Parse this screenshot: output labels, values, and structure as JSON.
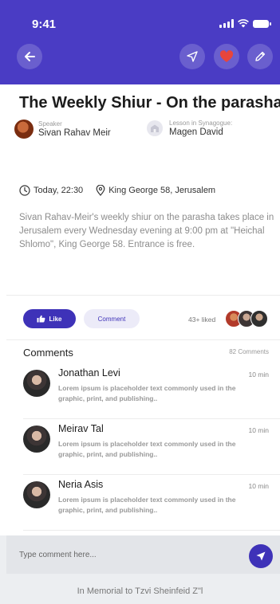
{
  "status_bar": {
    "time": "9:41"
  },
  "header": {
    "back_icon": "arrow-left-icon",
    "actions": [
      "navigate-icon",
      "heart-icon",
      "pencil-icon"
    ],
    "accent": "#4a3cc4",
    "heart_color": "#e8453c"
  },
  "lesson": {
    "title": "The Weekly Shiur - On the parasha",
    "speaker_label": "Speaker",
    "speaker_name": "Sivan Rahav Meir",
    "synagogue_label": "Lesson in Synagogue:",
    "synagogue_name": "Magen David",
    "datetime": "Today, 22:30",
    "location": "King George 58, Jerusalem",
    "description": "Sivan Rahav-Meir's weekly shiur on the parasha takes place in Jerusalem every Wednesday evening at 9:00 pm at \"Heichal Shlomo\", King George 58. Entrance is free."
  },
  "actions": {
    "like_label": "Like",
    "comment_label": "Comment",
    "liked_text": "43+ liked"
  },
  "comments": {
    "title": "Comments",
    "count_text": "82 Comments",
    "items": [
      {
        "name": "Jonathan Levi",
        "time": "10 min",
        "text": "Lorem ipsum is placeholder text commonly used in the graphic, print, and publishing.."
      },
      {
        "name": "Meirav Tal",
        "time": "10 min",
        "text": "Lorem ipsum is placeholder text commonly used in the graphic, print, and publishing.."
      },
      {
        "name": "Neria Asis",
        "time": "10 min",
        "text": "Lorem ipsum is placeholder text commonly used in the graphic, print, and publishing.."
      }
    ]
  },
  "composer": {
    "placeholder": "Type comment here..."
  },
  "footer": {
    "text": "In Memorial to Tzvi Sheinfeid Z\"l"
  }
}
